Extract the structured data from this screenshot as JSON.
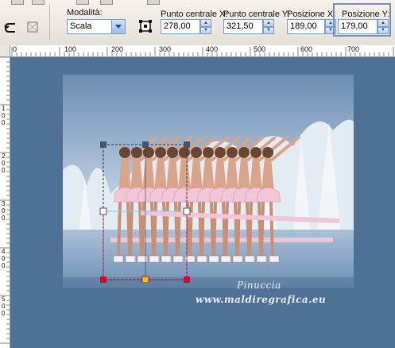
{
  "toolbar": {
    "mode_label": "Modalità:",
    "mode_value": "Scala",
    "center_x_label": "Punto centrale X:",
    "center_x_value": "278,00",
    "center_y_label": "Punto centrale Y:",
    "center_y_value": "321,50",
    "pos_x_label": "Posizione X:",
    "pos_x_value": "189,00",
    "pos_y_label": "Posizione Y:",
    "pos_y_value": "179,00"
  },
  "ruler": {
    "h_labels": [
      "0",
      "100",
      "200",
      "300",
      "400",
      "500",
      "600",
      "700"
    ],
    "v_labels": [
      "1\n0\n0",
      "2\n0\n0",
      "3\n0\n0",
      "4\n0\n0",
      "5\n0\n0"
    ]
  },
  "watermark": {
    "line1": "Pinuccia",
    "line2": "www.maldiregrafica.eu"
  },
  "colors": {
    "canvas_bg": "#4f7196",
    "selection": "#c8102e",
    "focus": "#6f90bc"
  }
}
